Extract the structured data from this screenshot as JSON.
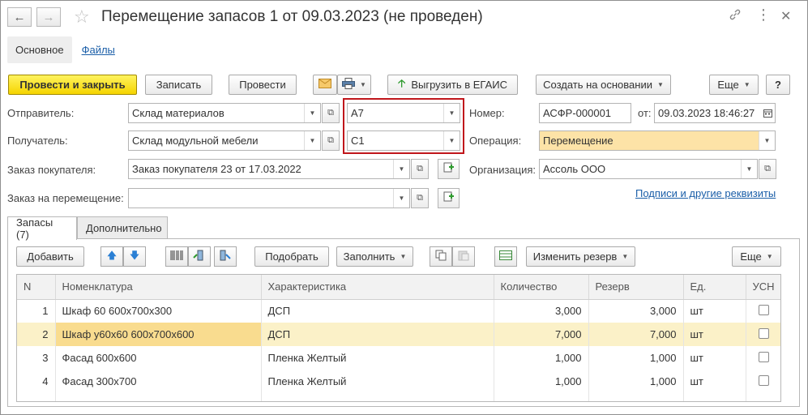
{
  "window": {
    "title": "Перемещение запасов 1 от 09.03.2023 (не проведен)",
    "back_icon": "arrow-left-icon",
    "forward_icon": "arrow-right-icon",
    "favorite_icon": "star-icon",
    "link_icon": "link-icon",
    "more_icon": "vertical-dots-icon",
    "close_icon": "close-icon"
  },
  "section_tabs": {
    "main": "Основное",
    "files": "Файлы"
  },
  "toolbar": {
    "post_and_close": "Провести и закрыть",
    "save": "Записать",
    "post": "Провести",
    "export_egais": "Выгрузить в ЕГАИС",
    "create_based_on": "Создать на основании",
    "more": "Еще",
    "help": "?"
  },
  "form": {
    "sender_label": "Отправитель:",
    "sender_value": "Склад материалов",
    "sender_cell": "А7",
    "receiver_label": "Получатель:",
    "receiver_value": "Склад модульной мебели",
    "receiver_cell": "С1",
    "customer_order_label": "Заказ покупателя:",
    "customer_order_value": "Заказ покупателя 23 от 17.03.2022",
    "transfer_order_label": "Заказ на перемещение:",
    "transfer_order_value": "",
    "number_label": "Номер:",
    "number_value": "АСФР-000001",
    "date_label": "от:",
    "date_value": "09.03.2023 18:46:27",
    "operation_label": "Операция:",
    "operation_value": "Перемещение",
    "organization_label": "Организация:",
    "organization_value": "Ассоль ООО",
    "signatures_link": "Подписи и другие реквизиты"
  },
  "tabs": [
    {
      "label": "Запасы (7)",
      "active": true
    },
    {
      "label": "Дополнительно",
      "active": false
    }
  ],
  "table_toolbar": {
    "add": "Добавить",
    "pick": "Подобрать",
    "fill": "Заполнить",
    "change_reserve": "Изменить резерв",
    "more": "Еще"
  },
  "table": {
    "columns": [
      "N",
      "Номенклатура",
      "Характеристика",
      "Количество",
      "Резерв",
      "Ед.",
      "УСН"
    ],
    "rows": [
      {
        "n": "1",
        "item": "Шкаф 60 600x700x300",
        "characteristic": "ДСП",
        "qty": "3,000",
        "reserve": "3,000",
        "unit": "шт",
        "usn": false
      },
      {
        "n": "2",
        "item": "Шкаф у60x60 600x700x600",
        "characteristic": "ДСП",
        "qty": "7,000",
        "reserve": "7,000",
        "unit": "шт",
        "usn": false
      },
      {
        "n": "3",
        "item": "Фасад 600x600",
        "characteristic": "Пленка Желтый",
        "qty": "1,000",
        "reserve": "1,000",
        "unit": "шт",
        "usn": false
      },
      {
        "n": "4",
        "item": "Фасад 300x700",
        "characteristic": "Пленка Желтый",
        "qty": "1,000",
        "reserve": "1,000",
        "unit": "шт",
        "usn": false
      }
    ],
    "selected_row": 2
  },
  "colors": {
    "primary_button": "#f5d400",
    "highlight_box": "#c0161b",
    "operation_field": "#fde3a7",
    "selected_row": "#fbf1c8",
    "link": "#1a5ea8"
  }
}
